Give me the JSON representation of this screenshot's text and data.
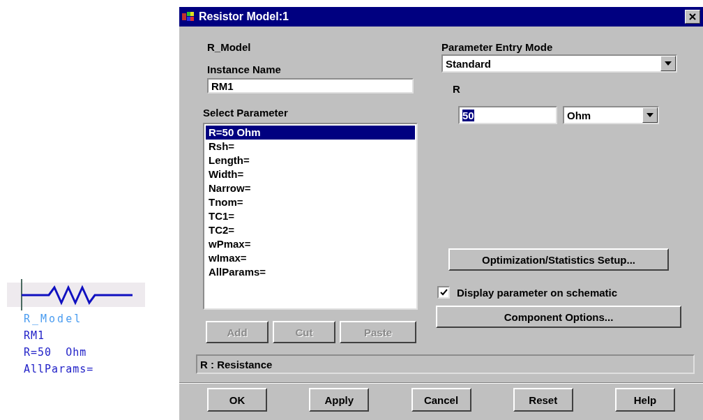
{
  "schematic": {
    "lines": [
      {
        "text": "R_Model",
        "kind": "name"
      },
      {
        "text": "RM1",
        "kind": "value"
      },
      {
        "text": "R=50  Ohm",
        "kind": "value"
      },
      {
        "text": "AllParams=",
        "kind": "value"
      }
    ]
  },
  "dialog": {
    "title": "Resistor Model:1",
    "model_name": "R_Model",
    "instance": {
      "label": "Instance Name",
      "value": "RM1"
    },
    "select": {
      "label": "Select Parameter",
      "items": [
        {
          "text": "R=50 Ohm",
          "selected": true
        },
        {
          "text": "Rsh=",
          "selected": false
        },
        {
          "text": "Length=",
          "selected": false
        },
        {
          "text": "Width=",
          "selected": false
        },
        {
          "text": "Narrow=",
          "selected": false
        },
        {
          "text": "Tnom=",
          "selected": false
        },
        {
          "text": "TC1=",
          "selected": false
        },
        {
          "text": "TC2=",
          "selected": false
        },
        {
          "text": "wPmax=",
          "selected": false
        },
        {
          "text": "wImax=",
          "selected": false
        },
        {
          "text": "AllParams=",
          "selected": false
        }
      ]
    },
    "list_buttons": [
      {
        "label": "Add",
        "disabled": true
      },
      {
        "label": "Cut",
        "disabled": true
      },
      {
        "label": "Paste",
        "disabled": true
      }
    ],
    "entry_mode": {
      "label": "Parameter Entry Mode",
      "value": "Standard"
    },
    "param": {
      "label": "R",
      "value": "50",
      "text_selected": true,
      "unit": "Ohm"
    },
    "optimization_button": "Optimization/Statistics Setup...",
    "display_checkbox": {
      "label": "Display parameter on schematic",
      "checked": true
    },
    "component_button": "Component Options...",
    "status": "R : Resistance",
    "footer_buttons": [
      "OK",
      "Apply",
      "Cancel",
      "Reset",
      "Help"
    ]
  }
}
